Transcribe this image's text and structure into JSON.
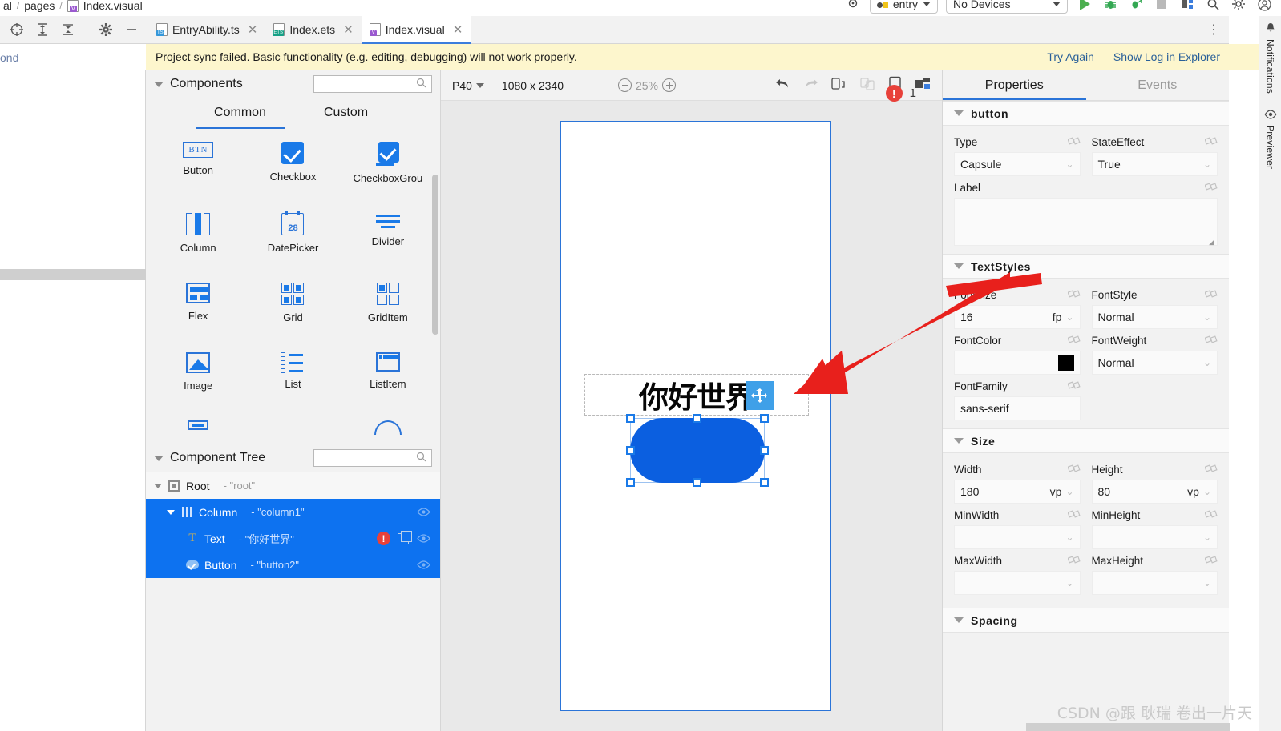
{
  "breadcrumb": {
    "parts": [
      "al",
      "pages",
      "Index.visual"
    ]
  },
  "run_toolbar": {
    "module": "entry",
    "device": "No Devices",
    "icons": [
      "location-icon",
      "run-icon",
      "debug-icon",
      "profile-icon",
      "stop-icon",
      "device-manager-icon",
      "search-icon",
      "settings-icon",
      "account-icon"
    ]
  },
  "tabbar": {
    "left_tools": [
      "target-icon",
      "expand-all-icon",
      "collapse-all-icon",
      "settings-gear-icon",
      "minimize-icon"
    ],
    "tabs": [
      {
        "label": "EntryAbility.ts",
        "badge": "TS",
        "active": false
      },
      {
        "label": "Index.ets",
        "badge": "ETS",
        "active": false
      },
      {
        "label": "Index.visual",
        "badge": "V",
        "active": true
      }
    ],
    "overflow": "more-options-icon"
  },
  "right_rail": [
    {
      "icon": "bell-icon",
      "label": "Notifications"
    },
    {
      "icon": "eye-icon",
      "label": "Previewer"
    }
  ],
  "banner": {
    "message": "Project sync failed. Basic functionality (e.g. editing, debugging) will not work properly.",
    "actions": [
      "Try Again",
      "Show Log in Explorer"
    ],
    "left_fragment": "ond"
  },
  "components_panel": {
    "title": "Components",
    "search_placeholder": "",
    "search_value": "",
    "tabs": [
      {
        "label": "Common",
        "active": true
      },
      {
        "label": "Custom",
        "active": false
      }
    ],
    "items": [
      {
        "label": "Button",
        "icon": "button-icon"
      },
      {
        "label": "Checkbox",
        "icon": "checkbox-icon"
      },
      {
        "label": "CheckboxGrou",
        "icon": "checkbox-group-icon"
      },
      {
        "label": "Column",
        "icon": "column-icon"
      },
      {
        "label": "DatePicker",
        "icon": "datepicker-icon",
        "day": "28"
      },
      {
        "label": "Divider",
        "icon": "divider-icon"
      },
      {
        "label": "Flex",
        "icon": "flex-icon"
      },
      {
        "label": "Grid",
        "icon": "grid-icon"
      },
      {
        "label": "GridItem",
        "icon": "griditem-icon"
      },
      {
        "label": "Image",
        "icon": "image-icon"
      },
      {
        "label": "List",
        "icon": "list-icon"
      },
      {
        "label": "ListItem",
        "icon": "listitem-icon"
      }
    ]
  },
  "component_tree": {
    "title": "Component Tree",
    "search_value": "",
    "rows": [
      {
        "name": "Root",
        "value": "- \"root\"",
        "icon": "root-icon",
        "indent": 0,
        "selected": false,
        "has_error": false,
        "has_copy": false,
        "has_eye": false
      },
      {
        "name": "Column",
        "value": "- \"column1\"",
        "icon": "column-icon",
        "indent": 1,
        "selected": true,
        "has_error": false,
        "has_copy": false,
        "has_eye": true
      },
      {
        "name": "Text",
        "value": "- \"你好世界\"",
        "icon": "text-icon",
        "indent": 2,
        "selected": true,
        "has_error": true,
        "has_copy": true,
        "has_eye": true
      },
      {
        "name": "Button",
        "value": "- \"button2\"",
        "icon": "button-icon",
        "indent": 2,
        "selected": true,
        "has_error": false,
        "has_copy": false,
        "has_eye": true
      }
    ]
  },
  "canvas": {
    "device": "P40",
    "resolution": "1080 x 2340",
    "zoom": "25%",
    "zoom_out_icon": "zoom-out-icon",
    "zoom_in_icon": "zoom-in-icon",
    "right_icons": [
      "undo-icon",
      "redo-icon",
      "rotate-device-icon",
      "link-icon",
      "frame-icon",
      "multi-device-icon"
    ],
    "error_count": "1",
    "preview": {
      "text_element": "你好世界",
      "button_element": "",
      "move_handle_icon": "move-icon"
    }
  },
  "properties": {
    "tabs": [
      {
        "label": "Properties",
        "active": true
      },
      {
        "label": "Events",
        "active": false
      }
    ],
    "sections": [
      {
        "title": "button",
        "fields": [
          {
            "label": "Type",
            "value": "Capsule",
            "kind": "select",
            "unit": ""
          },
          {
            "label": "StateEffect",
            "value": "True",
            "kind": "select",
            "unit": ""
          },
          {
            "label": "Label",
            "value": "",
            "kind": "textarea",
            "unit": ""
          }
        ]
      },
      {
        "title": "TextStyles",
        "fields": [
          {
            "label": "FontSize",
            "value": "16",
            "kind": "unit-select",
            "unit": "fp"
          },
          {
            "label": "FontStyle",
            "value": "Normal",
            "kind": "select",
            "unit": ""
          },
          {
            "label": "FontColor",
            "value": "",
            "kind": "color",
            "unit": "",
            "color": "#000000"
          },
          {
            "label": "FontWeight",
            "value": "Normal",
            "kind": "select",
            "unit": ""
          },
          {
            "label": "FontFamily",
            "value": "sans-serif",
            "kind": "text",
            "unit": ""
          }
        ]
      },
      {
        "title": "Size",
        "fields": [
          {
            "label": "Width",
            "value": "180",
            "kind": "unit-select",
            "unit": "vp"
          },
          {
            "label": "Height",
            "value": "80",
            "kind": "unit-select",
            "unit": "vp"
          },
          {
            "label": "MinWidth",
            "value": "",
            "kind": "select",
            "unit": ""
          },
          {
            "label": "MinHeight",
            "value": "",
            "kind": "select",
            "unit": ""
          },
          {
            "label": "MaxWidth",
            "value": "",
            "kind": "select",
            "unit": ""
          },
          {
            "label": "MaxHeight",
            "value": "",
            "kind": "select",
            "unit": ""
          }
        ]
      },
      {
        "title": "Spacing",
        "fields": []
      }
    ]
  },
  "watermark": "CSDN @跟 耿瑞 卷出一片天",
  "colors": {
    "accent": "#2a74d8",
    "selection": "#0d72f0",
    "button_blue": "#0b5fe0",
    "banner_bg": "#fdf6cd",
    "error_red": "#e8413a",
    "annotation_red": "#e8201c"
  }
}
